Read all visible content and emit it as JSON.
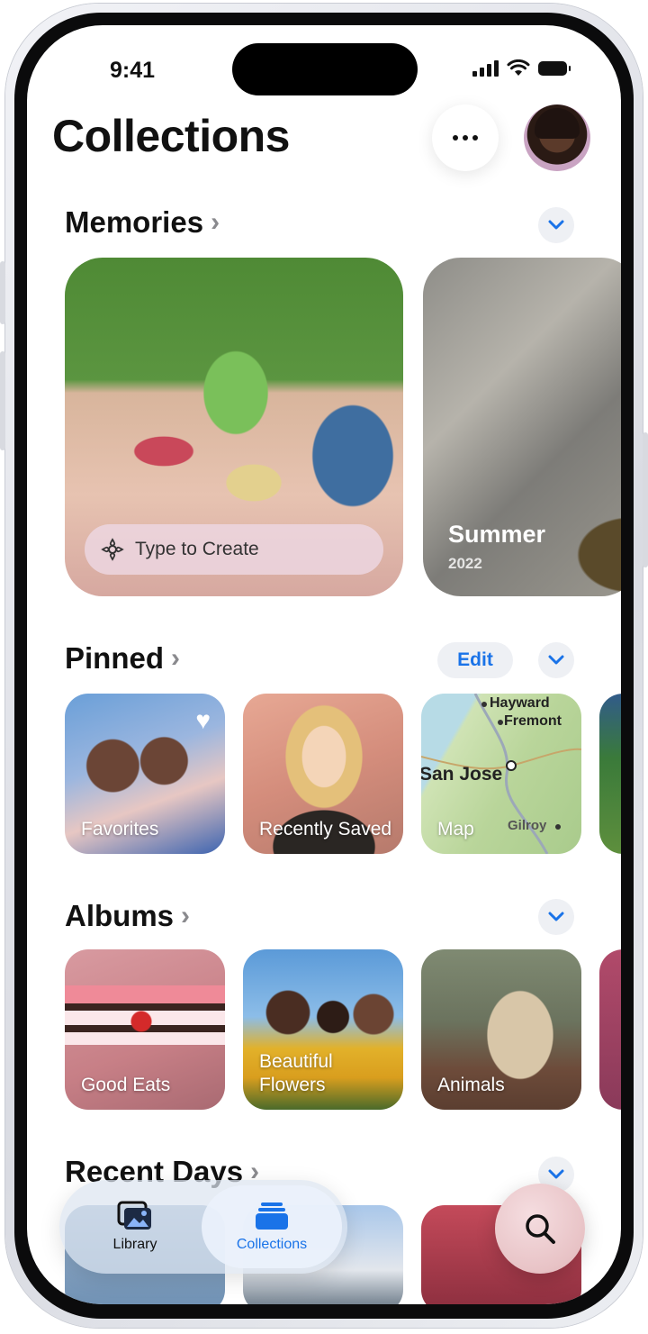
{
  "status_bar": {
    "time": "9:41"
  },
  "header": {
    "title": "Collections"
  },
  "memories": {
    "title": "Memories",
    "type_to_create": "Type to Create",
    "cards": [
      {
        "label": "Summer",
        "sub": "2022"
      }
    ]
  },
  "pinned": {
    "title": "Pinned",
    "edit_label": "Edit",
    "tiles": [
      {
        "label": "Favorites"
      },
      {
        "label": "Recently Saved"
      },
      {
        "label": "Map"
      }
    ],
    "map_places": [
      "Hayward",
      "Fremont",
      "San Jose",
      "Gilroy"
    ]
  },
  "albums": {
    "title": "Albums",
    "tiles": [
      {
        "label": "Good Eats"
      },
      {
        "label": "Beautiful Flowers"
      },
      {
        "label": "Animals"
      }
    ]
  },
  "recent_days": {
    "title": "Recent Days"
  },
  "tab_bar": {
    "tabs": [
      {
        "label": "Library",
        "icon": "photo-stack-icon"
      },
      {
        "label": "Collections",
        "icon": "collections-stack-icon"
      }
    ],
    "active": "Collections",
    "search_icon": "search-icon"
  },
  "colors": {
    "accent": "#1a73e8",
    "text": "#111111",
    "secondary": "#8a8a8e"
  }
}
